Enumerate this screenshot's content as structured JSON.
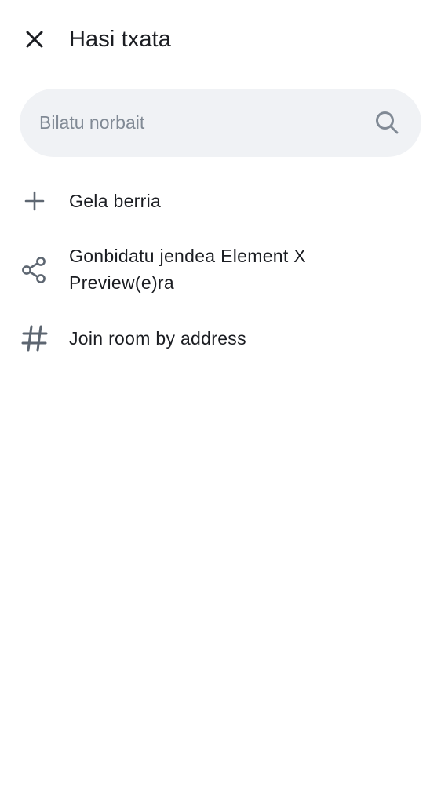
{
  "header": {
    "title": "Hasi txata",
    "close_icon": "close-icon"
  },
  "search": {
    "placeholder": "Bilatu norbait",
    "value": "",
    "icon": "search-icon"
  },
  "menu": {
    "items": [
      {
        "icon": "plus-icon",
        "label": "Gela berria"
      },
      {
        "icon": "share-icon",
        "label": "Gonbidatu jendea Element X Preview(e)ra"
      },
      {
        "icon": "hash-icon",
        "label": "Join room by address"
      }
    ]
  },
  "colors": {
    "icon": "#5d6671",
    "search_background": "#f0f2f5",
    "placeholder": "#818a95",
    "text": "#1b1d22"
  }
}
